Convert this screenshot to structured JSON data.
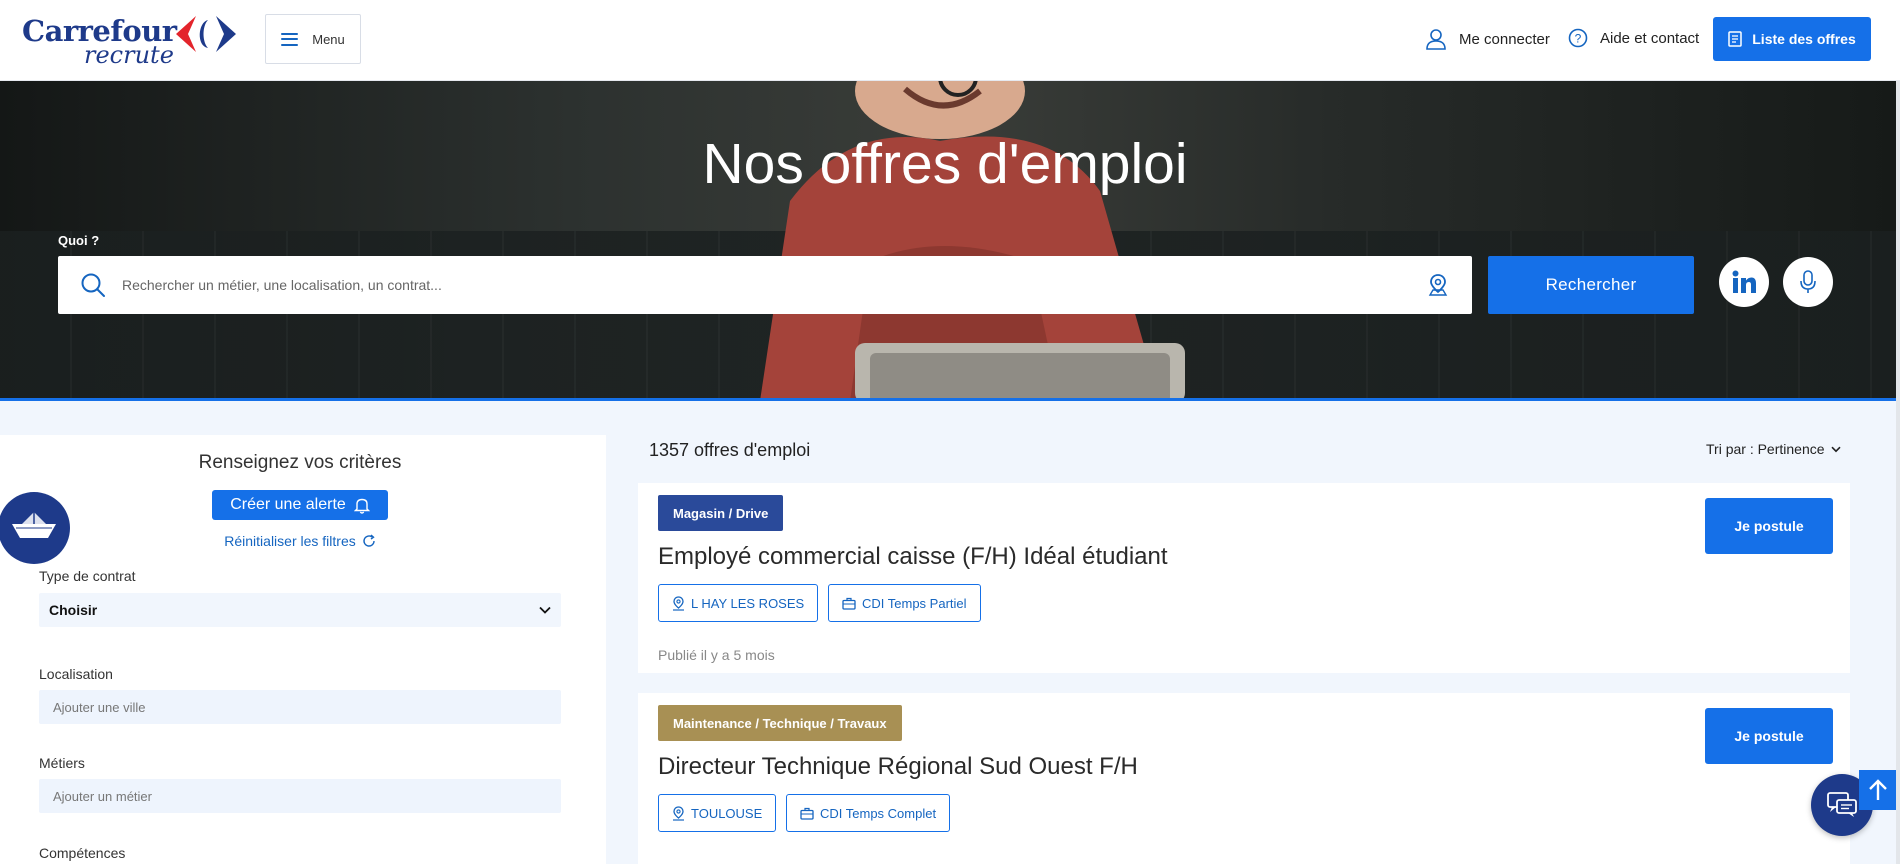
{
  "header": {
    "logo_line1": "Carrefour",
    "logo_line2": "recrute",
    "menu_label": "Menu",
    "connect_label": "Me connecter",
    "help_label": "Aide et contact",
    "offers_label": "Liste des offres"
  },
  "hero": {
    "title": "Nos offres d'emploi",
    "search_label": "Quoi ?",
    "search_placeholder": "Rechercher un métier, une localisation, un contrat...",
    "search_button": "Rechercher"
  },
  "sidebar": {
    "title": "Renseignez vos critères",
    "alert_button": "Créer une alerte",
    "reset_link": "Réinitialiser les filtres",
    "contract_label": "Type de contrat",
    "contract_value": "Choisir",
    "location_label": "Localisation",
    "location_placeholder": "Ajouter une ville",
    "jobs_label": "Métiers",
    "jobs_placeholder": "Ajouter un métier",
    "skills_label": "Compétences"
  },
  "results": {
    "count": "1357 offres d'emploi",
    "sort_label": "Tri par : Pertinence",
    "apply_label": "Je postule",
    "jobs": [
      {
        "category": "Magasin / Drive",
        "title": "Employé commercial caisse (F/H) Idéal étudiant",
        "location": "L HAY LES ROSES",
        "contract": "CDI Temps Partiel",
        "published": "Publié il y a 5 mois"
      },
      {
        "category": "Maintenance / Technique / Travaux",
        "title": "Directeur Technique Régional Sud Ouest F/H",
        "location": "TOULOUSE",
        "contract": "CDI Temps Complet"
      }
    ]
  },
  "colors": {
    "primary": "#1570e8",
    "brand_dark": "#1e3a8a",
    "category_blue": "#2a4a9a",
    "category_gold": "#a89054"
  },
  "icons": [
    "menu-icon",
    "user-icon",
    "help-icon",
    "list-icon",
    "search-icon",
    "geo-location-icon",
    "linkedin-icon",
    "microphone-icon",
    "bell-icon",
    "refresh-icon",
    "chevron-down-icon",
    "location-pin-icon",
    "briefcase-icon",
    "boat-icon",
    "chat-icon",
    "arrow-up-icon"
  ]
}
